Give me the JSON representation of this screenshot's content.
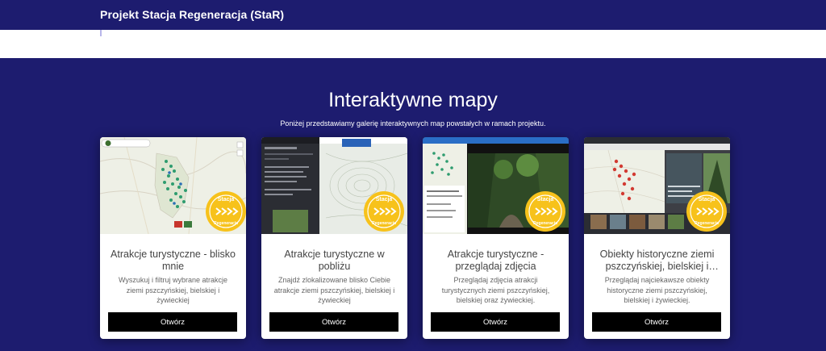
{
  "header": {
    "title": "Projekt Stacja Regeneracja (StaR)"
  },
  "section": {
    "title": "Interaktywne mapy",
    "subtitle": "Poniżej przedstawiamy galerię interaktywnych map powstałych w ramach projektu."
  },
  "badge": {
    "line1": "Stacja",
    "line2": "Regeneracja"
  },
  "cards": [
    {
      "title": "Atrakcje turystyczne - blisko mnie",
      "description": "Wyszukuj i filtruj wybrane atrakcje ziemi pszczyńskiej, bielskiej i żywieckiej",
      "button": "Otwórz"
    },
    {
      "title": "Atrakcje turystyczne w pobliżu",
      "description": "Znajdź zlokalizowane blisko Ciebie atrakcje ziemi pszczyńskiej, bielskiej i żywieckiej",
      "button": "Otwórz"
    },
    {
      "title": "Atrakcje turystyczne - przeglądaj zdjęcia",
      "description": "Przeglądaj zdjęcia atrakcji turystycznych ziemi pszczyńskiej, bielskiej oraz żywieckiej.",
      "button": "Otwórz"
    },
    {
      "title": "Obiekty historyczne ziemi pszczyńskiej, bielskiej i żywieckiej",
      "description": "Przeglądaj najciekawsze obiekty historyczne ziemi pszczyńskiej, bielskiej i żywieckiej.",
      "button": "Otwórz"
    }
  ]
}
